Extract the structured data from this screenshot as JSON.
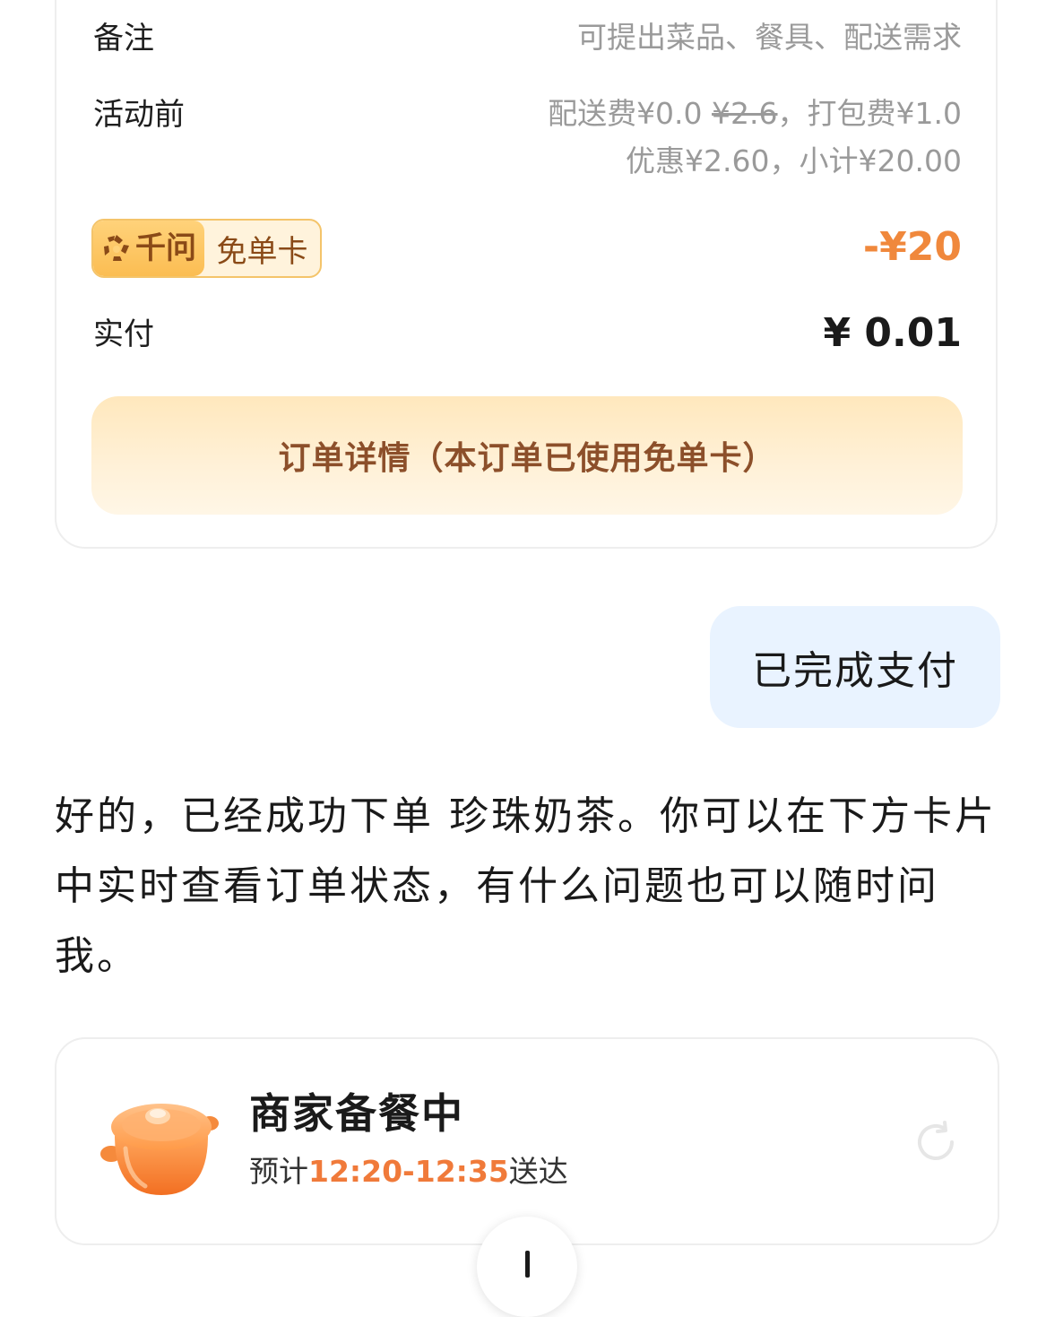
{
  "order_summary": {
    "remark_label": "备注",
    "remark_placeholder": "可提出菜品、餐具、配送需求",
    "activity_label": "活动前",
    "delivery_fee_text": "配送费¥0.0 ",
    "delivery_fee_original": "¥2.6",
    "packing_fee_text": "，打包费¥1.0",
    "discount_subtotal_text": "优惠¥2.60，小计¥20.00",
    "badge_brand": "千问",
    "badge_card": "免单卡",
    "badge_discount": "-¥20",
    "paid_label": "实付",
    "paid_value": "¥ 0.01",
    "detail_button": "订单详情（本订单已使用免单卡）"
  },
  "user_message": "已完成支付",
  "assistant_message": "好的，已经成功下单 珍珠奶茶。你可以在下方卡片中实时查看订单状态，有什么问题也可以随时问我。",
  "status_card": {
    "title": "商家备餐中",
    "eta_prefix": "预计",
    "eta_time": "12:20-12:35",
    "eta_suffix": "送达",
    "icon": "cooking-pot-icon"
  },
  "icons": {
    "badge_logo": "qianwen-logo-icon",
    "refresh": "refresh-icon",
    "scroll_down": "arrow-down-icon"
  },
  "colors": {
    "accent_orange": "#f0883c",
    "badge_gold": "#fbbd52",
    "detail_text_brown": "#8c4f2a",
    "user_bubble_bg": "#e9f3ff"
  }
}
